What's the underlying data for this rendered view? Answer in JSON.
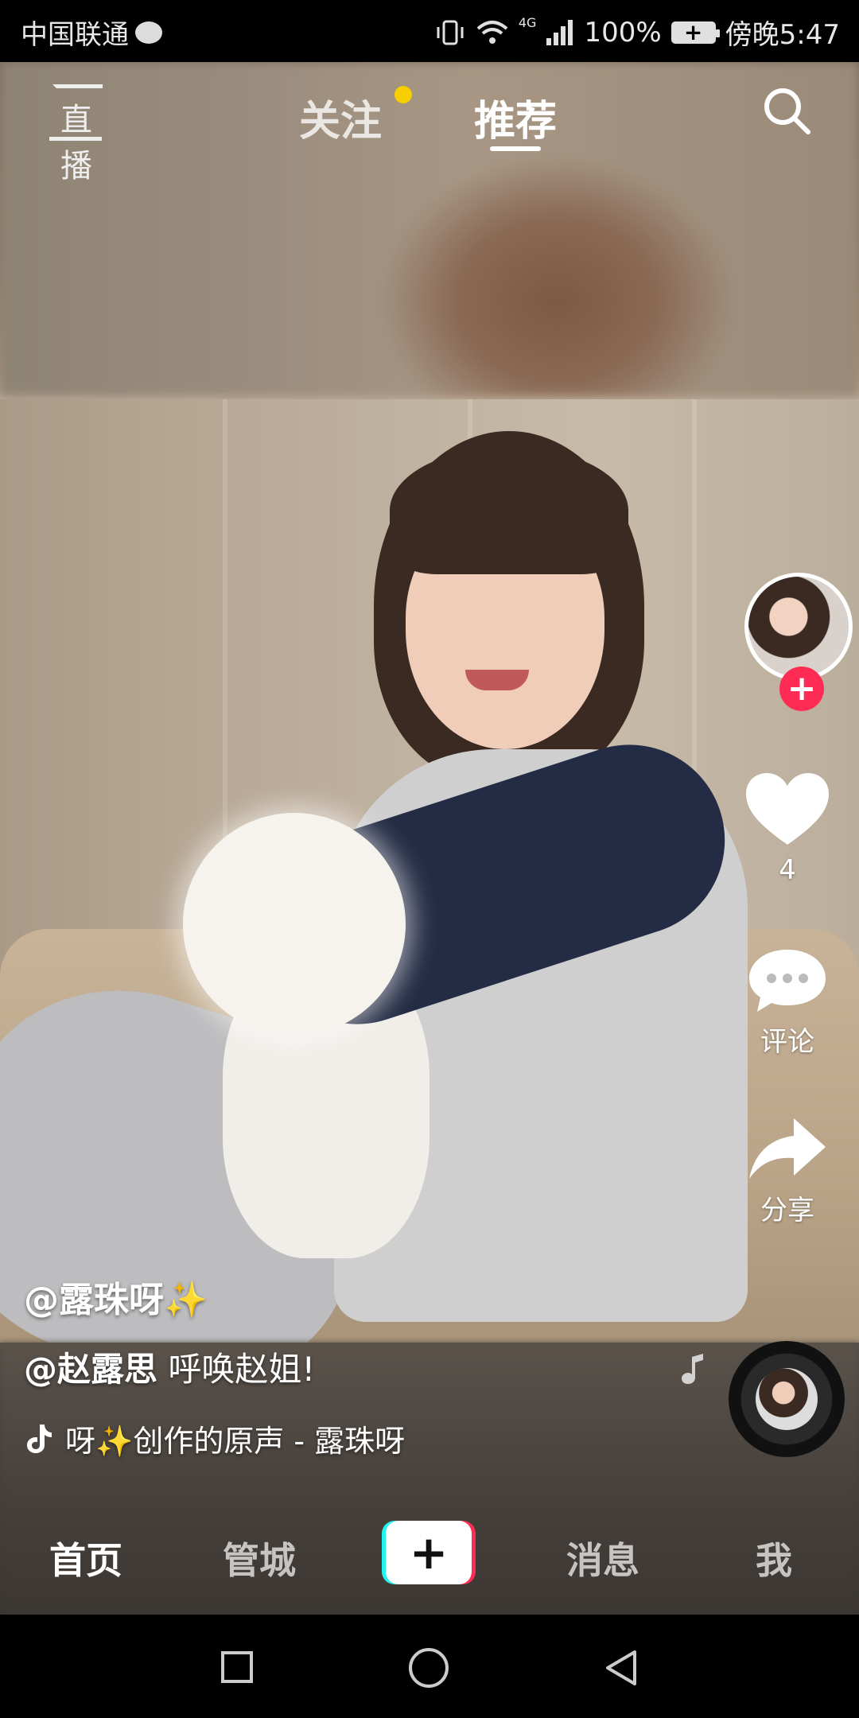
{
  "status_bar": {
    "carrier": "中国联通",
    "network": "4G",
    "battery": "100%",
    "time": "傍晚5:47"
  },
  "top_nav": {
    "live_label": "直播",
    "tabs": [
      {
        "label": "关注",
        "has_dot": true
      },
      {
        "label": "推荐",
        "active": true
      }
    ],
    "icons": [
      "live-icon",
      "search-icon"
    ]
  },
  "right_rail": {
    "like_count": "4",
    "comment_label": "评论",
    "share_label": "分享",
    "follow_symbol": "+"
  },
  "caption": {
    "author": "@露珠呀✨",
    "mention": "@赵露思",
    "mention_text": "呼唤赵姐!",
    "music": "呀✨创作的原声 - 露珠呀"
  },
  "tab_bar": {
    "home": "首页",
    "mall": "管城",
    "add": "+",
    "messages": "消息",
    "me": "我"
  },
  "colors": {
    "accent_red": "#fe2c55",
    "accent_cyan": "#25f4ee",
    "dot_yellow": "#f7ce00"
  }
}
